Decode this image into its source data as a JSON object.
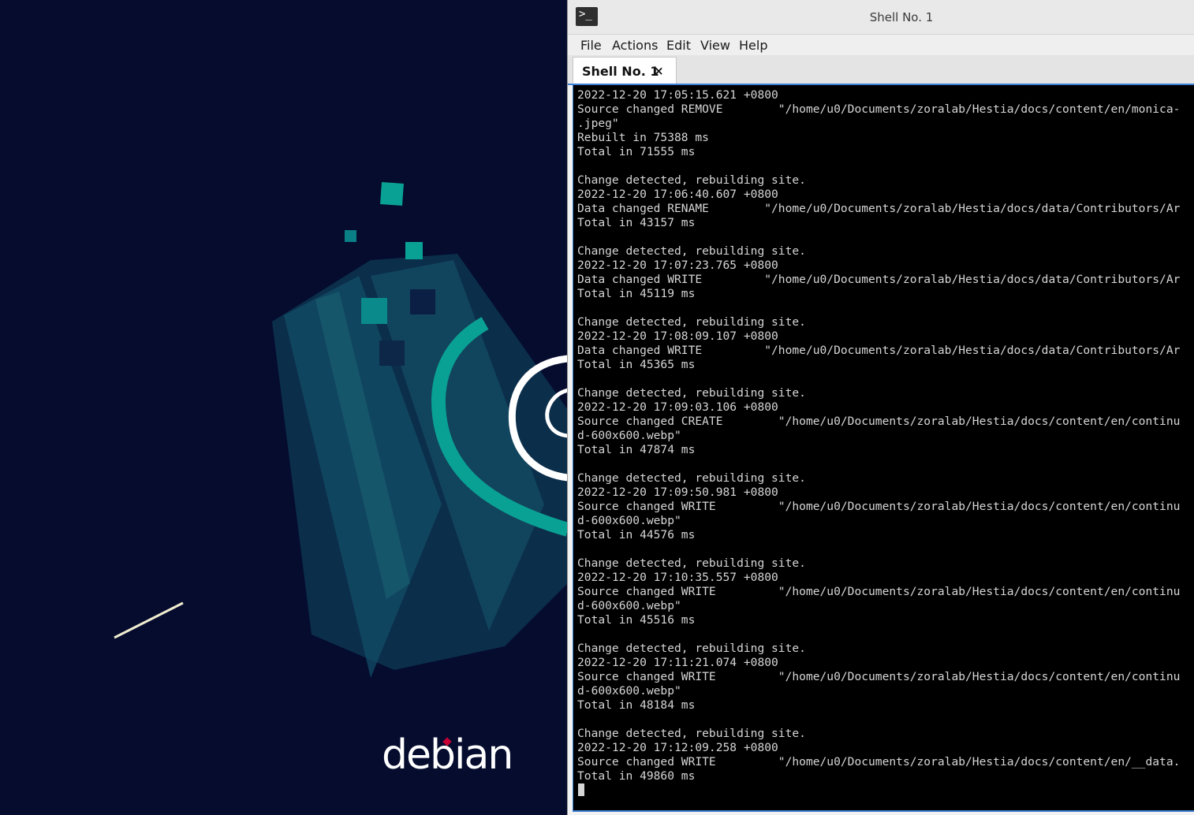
{
  "desktop": {
    "wallpaper_brand": "debian"
  },
  "window": {
    "title": "Shell No. 1",
    "icon": "terminal-icon",
    "menu": [
      "File",
      "Actions",
      "Edit",
      "View",
      "Help"
    ],
    "tab": {
      "label": "Shell No. 1",
      "close": "×"
    }
  },
  "terminal": {
    "lines": [
      "2022-12-20 17:05:15.621 +0800",
      "Source changed REMOVE        \"/home/u0/Documents/zoralab/Hestia/docs/content/en/monica-",
      ".jpeg\"",
      "Rebuilt in 75388 ms",
      "Total in 71555 ms",
      "",
      "Change detected, rebuilding site.",
      "2022-12-20 17:06:40.607 +0800",
      "Data changed RENAME        \"/home/u0/Documents/zoralab/Hestia/docs/data/Contributors/Ar",
      "Total in 43157 ms",
      "",
      "Change detected, rebuilding site.",
      "2022-12-20 17:07:23.765 +0800",
      "Data changed WRITE         \"/home/u0/Documents/zoralab/Hestia/docs/data/Contributors/Ar",
      "Total in 45119 ms",
      "",
      "Change detected, rebuilding site.",
      "2022-12-20 17:08:09.107 +0800",
      "Data changed WRITE         \"/home/u0/Documents/zoralab/Hestia/docs/data/Contributors/Ar",
      "Total in 45365 ms",
      "",
      "Change detected, rebuilding site.",
      "2022-12-20 17:09:03.106 +0800",
      "Source changed CREATE        \"/home/u0/Documents/zoralab/Hestia/docs/content/en/continu",
      "d-600x600.webp\"",
      "Total in 47874 ms",
      "",
      "Change detected, rebuilding site.",
      "2022-12-20 17:09:50.981 +0800",
      "Source changed WRITE         \"/home/u0/Documents/zoralab/Hestia/docs/content/en/continu",
      "d-600x600.webp\"",
      "Total in 44576 ms",
      "",
      "Change detected, rebuilding site.",
      "2022-12-20 17:10:35.557 +0800",
      "Source changed WRITE         \"/home/u0/Documents/zoralab/Hestia/docs/content/en/continu",
      "d-600x600.webp\"",
      "Total in 45516 ms",
      "",
      "Change detected, rebuilding site.",
      "2022-12-20 17:11:21.074 +0800",
      "Source changed WRITE         \"/home/u0/Documents/zoralab/Hestia/docs/content/en/continu",
      "d-600x600.webp\"",
      "Total in 48184 ms",
      "",
      "Change detected, rebuilding site.",
      "2022-12-20 17:12:09.258 +0800",
      "Source changed WRITE         \"/home/u0/Documents/zoralab/Hestia/docs/content/en/__data.",
      "Total in 49860 ms"
    ]
  },
  "colors": {
    "desktop_bg": "#050c2e",
    "accent_teal": "#0aa195",
    "terminal_bg": "#000000",
    "terminal_fg": "#d6d6d6",
    "focus_blue": "#3d7fd6"
  }
}
